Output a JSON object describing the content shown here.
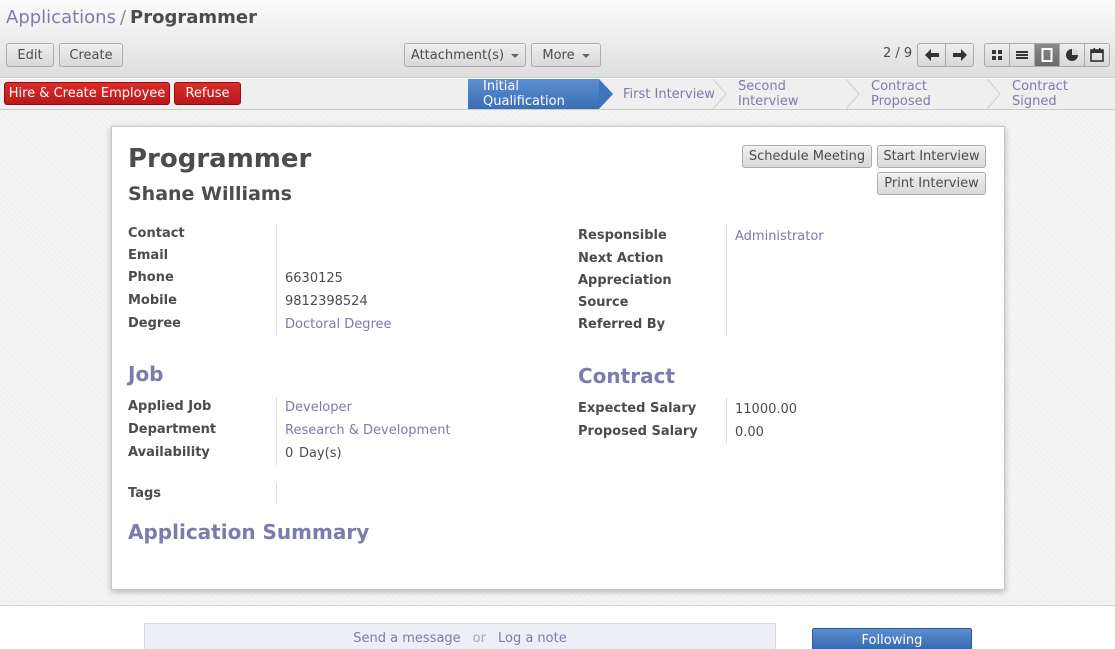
{
  "breadcrumb": {
    "parent": "Applications",
    "separator": "/",
    "current": "Programmer"
  },
  "toolbar": {
    "edit": "Edit",
    "create": "Create",
    "attachments": "Attachment(s)",
    "more": "More",
    "pager": "2 / 9",
    "icons": [
      "arrow-left-icon",
      "arrow-right-icon",
      "kanban-view-icon",
      "list-view-icon",
      "form-view-icon",
      "graph-view-icon",
      "calendar-view-icon"
    ]
  },
  "status": {
    "hire": "Hire & Create Employee",
    "refuse": "Refuse",
    "stages": [
      "Initial Qualification",
      "First Interview",
      "Second Interview",
      "Contract Proposed",
      "Contract Signed"
    ],
    "active_stage": "Initial Qualification"
  },
  "form": {
    "title": "Programmer",
    "applicant": "Shane Williams",
    "buttons": {
      "schedule": "Schedule Meeting",
      "start": "Start Interview",
      "print": "Print Interview"
    },
    "left": {
      "contact": {
        "label": "Contact",
        "value": ""
      },
      "email": {
        "label": "Email",
        "value": ""
      },
      "phone": {
        "label": "Phone",
        "value": "6630125"
      },
      "mobile": {
        "label": "Mobile",
        "value": "9812398524"
      },
      "degree": {
        "label": "Degree",
        "value": "Doctoral Degree"
      }
    },
    "right": {
      "responsible": {
        "label": "Responsible",
        "value": "Administrator"
      },
      "next_action": {
        "label": "Next Action",
        "value": ""
      },
      "appreciation": {
        "label": "Appreciation",
        "value": ""
      },
      "source": {
        "label": "Source",
        "value": ""
      },
      "referred_by": {
        "label": "Referred By",
        "value": ""
      }
    },
    "job": {
      "heading": "Job",
      "applied_job": {
        "label": "Applied Job",
        "value": "Developer"
      },
      "department": {
        "label": "Department",
        "value": "Research & Development"
      },
      "availability": {
        "label": "Availability",
        "value": "0",
        "unit": "Day(s)"
      }
    },
    "contract": {
      "heading": "Contract",
      "expected_salary": {
        "label": "Expected Salary",
        "value": "11000.00"
      },
      "proposed_salary": {
        "label": "Proposed Salary",
        "value": "0.00"
      }
    },
    "tags": {
      "label": "Tags",
      "value": ""
    },
    "summary_heading": "Application Summary"
  },
  "chatter": {
    "send_message": "Send a message",
    "or": "or",
    "log_note": "Log a note",
    "following": "Following"
  },
  "colors": {
    "link": "#7c7bad",
    "active_stage": "#4a80c4",
    "danger": "#c92121"
  }
}
